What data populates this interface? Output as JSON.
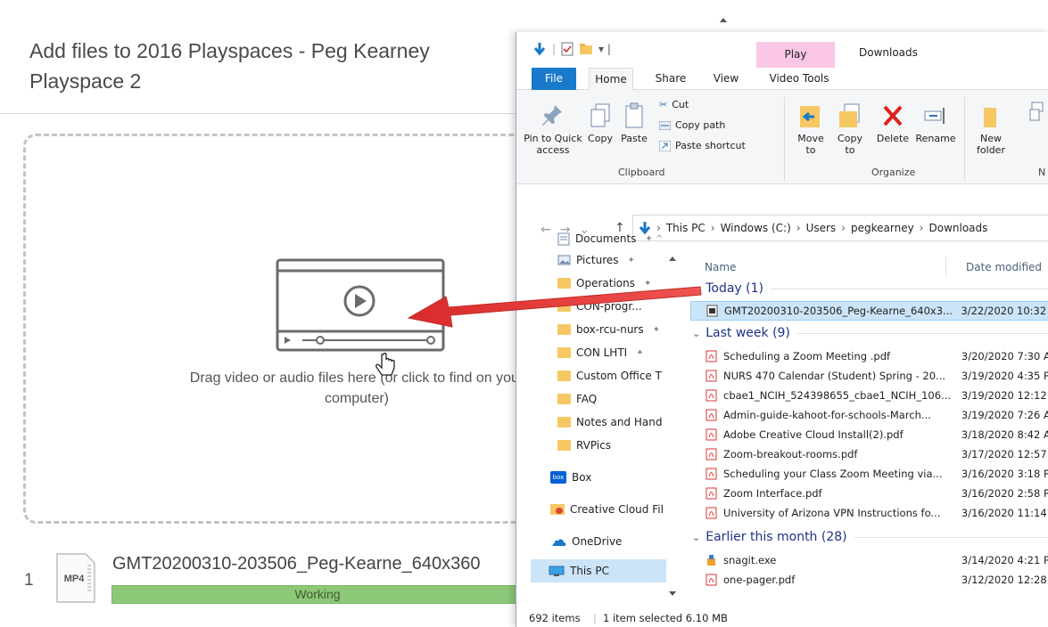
{
  "page": {
    "title": "Add files to 2016 Playspaces - Peg Kearney Playspace 2",
    "drop_text": "Drag video or audio files here (or click to find on your computer)",
    "queue": {
      "index": "1",
      "file_type": "MP4",
      "file_name": "GMT20200310-203506_Peg-Kearne_640x360",
      "status": "Working",
      "progress": 1.0
    }
  },
  "explorer": {
    "context_tab": "Play",
    "window_title": "Downloads",
    "tabs": [
      "File",
      "Home",
      "Share",
      "View",
      "Video Tools"
    ],
    "ribbon": {
      "pin_label": "Pin to Quick access",
      "copy_label": "Copy",
      "paste_label": "Paste",
      "cut_label": "Cut",
      "copy_path_label": "Copy path",
      "paste_shortcut_label": "Paste shortcut",
      "clipboard_group": "Clipboard",
      "move_to_label": "Move to",
      "copy_to_label": "Copy to",
      "delete_label": "Delete",
      "rename_label": "Rename",
      "organize_group": "Organize",
      "new_folder_label": "New folder",
      "new_group_partial": "N"
    },
    "breadcrumb": [
      "This PC",
      "Windows (C:)",
      "Users",
      "pegkearney",
      "Downloads"
    ],
    "nav_items": [
      {
        "label": "Documents",
        "pinned": true,
        "icon": "documents-icon"
      },
      {
        "label": "Pictures",
        "pinned": true,
        "icon": "pictures-icon"
      },
      {
        "label": "Operations",
        "pinned": true,
        "icon": "folder-icon"
      },
      {
        "label": "CON-progr...",
        "pinned": true,
        "icon": "folder-icon"
      },
      {
        "label": "box-rcu-nurs",
        "pinned": true,
        "icon": "folder-icon"
      },
      {
        "label": "CON LHTI",
        "pinned": true,
        "icon": "folder-icon"
      },
      {
        "label": "Custom Office T",
        "pinned": false,
        "icon": "folder-icon"
      },
      {
        "label": "FAQ",
        "pinned": false,
        "icon": "folder-icon"
      },
      {
        "label": "Notes and Hand",
        "pinned": false,
        "icon": "folder-icon"
      },
      {
        "label": "RVPics",
        "pinned": false,
        "icon": "folder-icon"
      },
      {
        "label": "Box",
        "pinned": false,
        "icon": "box-icon"
      },
      {
        "label": "Creative Cloud Fil",
        "pinned": false,
        "icon": "creative-cloud-icon"
      },
      {
        "label": "OneDrive",
        "pinned": false,
        "icon": "onedrive-icon"
      },
      {
        "label": "This PC",
        "pinned": false,
        "icon": "this-pc-icon"
      }
    ],
    "columns": {
      "name": "Name",
      "date": "Date modified"
    },
    "groups": [
      {
        "title": "Today (1)",
        "files": [
          {
            "name": "GMT20200310-203506_Peg-Kearne_640x3...",
            "date": "3/22/2020 10:32",
            "type": "video"
          }
        ]
      },
      {
        "title": "Last week (9)",
        "files": [
          {
            "name": "Scheduling a Zoom Meeting .pdf",
            "date": "3/20/2020 7:30 A",
            "type": "pdf"
          },
          {
            "name": "NURS 470 Calendar (Student) Spring - 20...",
            "date": "3/19/2020 4:35 P",
            "type": "pdf"
          },
          {
            "name": "cbae1_NCIH_524398655_cbae1_NCIH_106...",
            "date": "3/19/2020 12:12",
            "type": "pdf"
          },
          {
            "name": "Admin-guide-kahoot-for-schools-March...",
            "date": "3/19/2020 7:26 A",
            "type": "pdf"
          },
          {
            "name": "Adobe Creative Cloud Install(2).pdf",
            "date": "3/18/2020 8:42 A",
            "type": "pdf"
          },
          {
            "name": "Zoom-breakout-rooms.pdf",
            "date": "3/17/2020 12:57",
            "type": "pdf"
          },
          {
            "name": "Scheduling your Class Zoom Meeting via...",
            "date": "3/16/2020 3:18 P",
            "type": "pdf"
          },
          {
            "name": "Zoom Interface.pdf",
            "date": "3/16/2020 2:58 P",
            "type": "pdf"
          },
          {
            "name": "University of Arizona VPN Instructions fo...",
            "date": "3/16/2020 11:14",
            "type": "pdf"
          }
        ]
      },
      {
        "title": "Earlier this month (28)",
        "files": [
          {
            "name": "snagit.exe",
            "date": "3/14/2020 4:21 P",
            "type": "exe"
          },
          {
            "name": "one-pager.pdf",
            "date": "3/12/2020 12:28",
            "type": "pdf"
          }
        ]
      }
    ],
    "status": {
      "items": "692 items",
      "selected": "1 item selected  6.10 MB"
    }
  },
  "colors": {
    "file_tab": "#1979ca",
    "play_tab": "#f9c6e6",
    "selection": "#cce4f7",
    "progress": "#8cc878",
    "arrow": "#e8413d"
  }
}
